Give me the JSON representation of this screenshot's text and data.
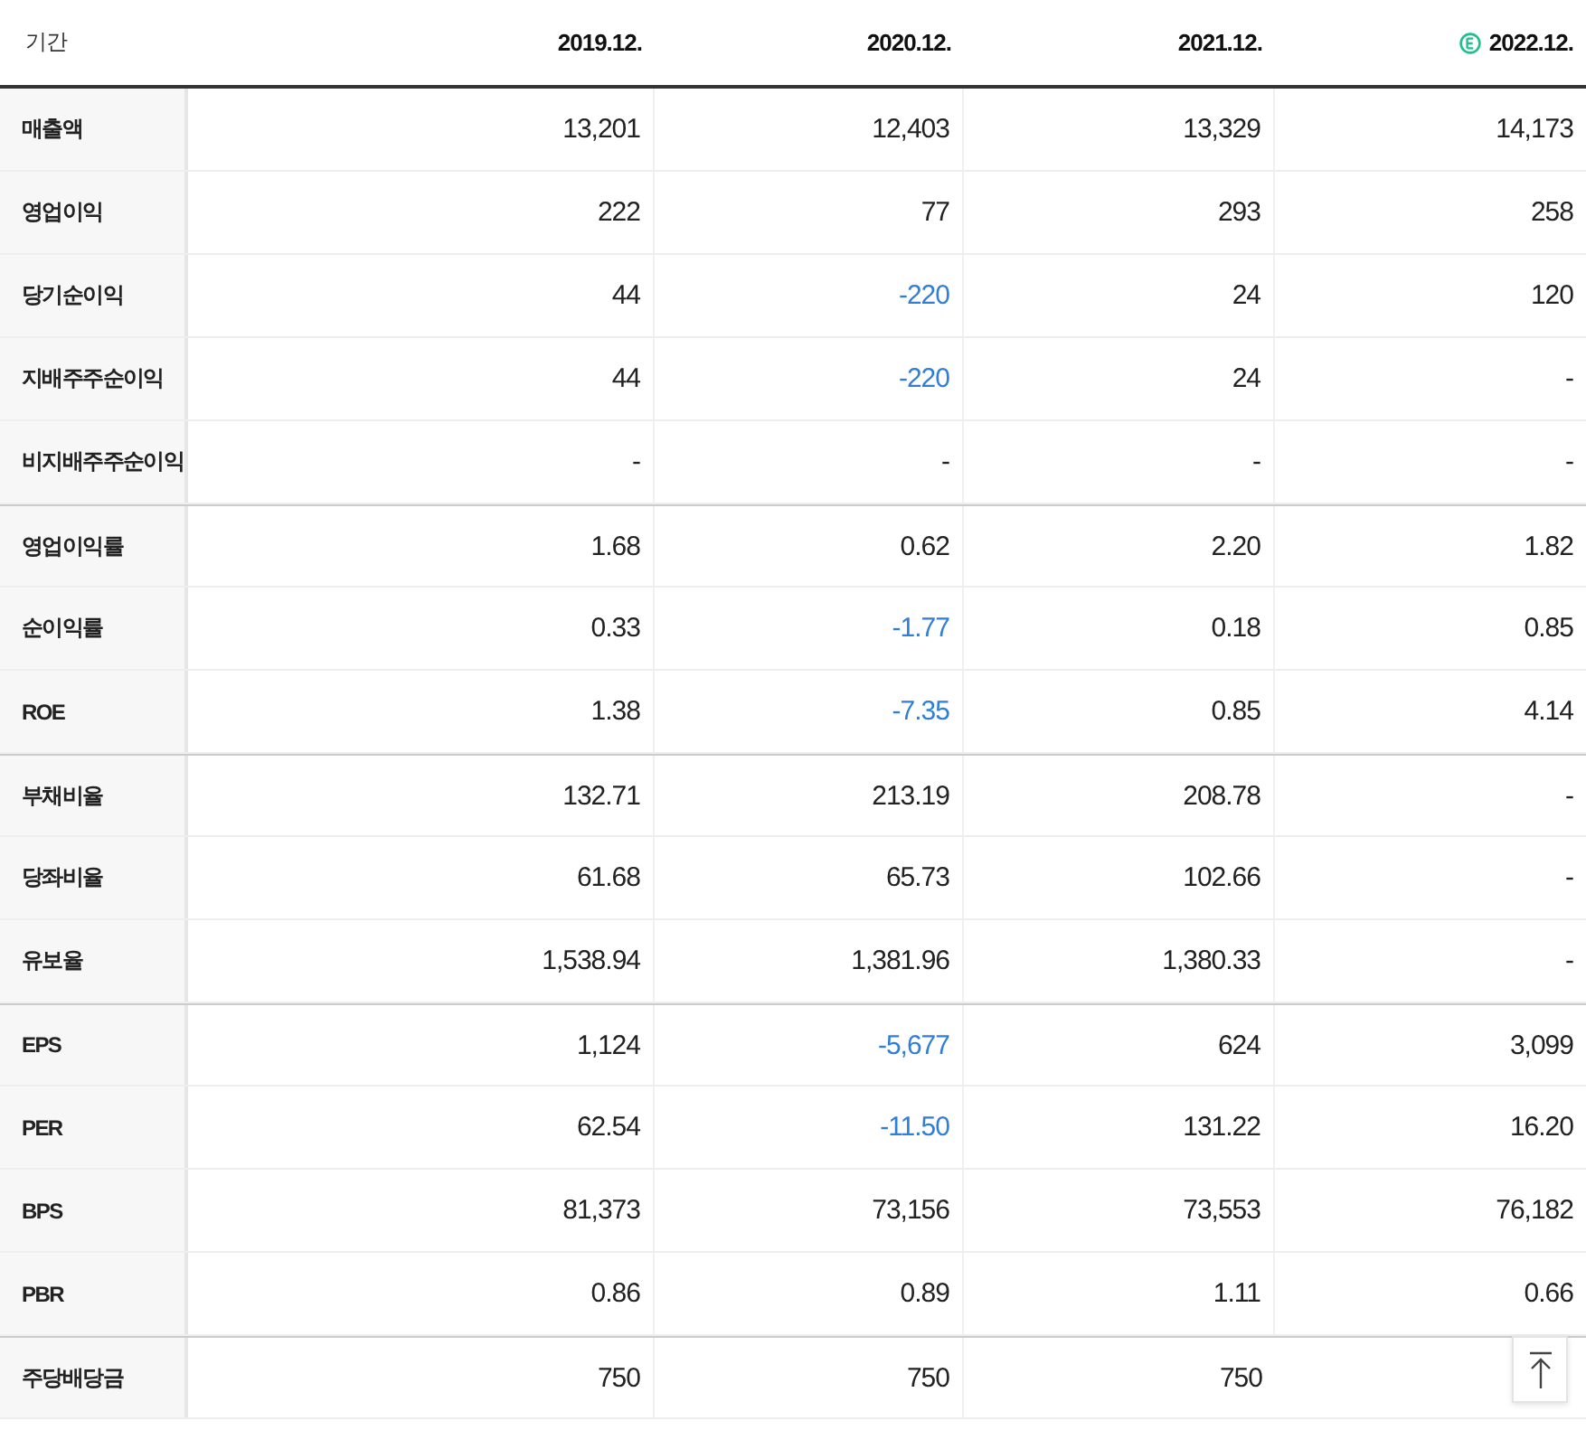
{
  "table": {
    "row_header": "기간",
    "columns": [
      {
        "label": "2019.12.",
        "estimate": false
      },
      {
        "label": "2020.12.",
        "estimate": false
      },
      {
        "label": "2021.12.",
        "estimate": false
      },
      {
        "label": "2022.12.",
        "estimate": true
      }
    ],
    "rows": [
      {
        "label": "매출액",
        "group_start": false,
        "cells": [
          {
            "text": "13,201",
            "kind": "normal"
          },
          {
            "text": "12,403",
            "kind": "normal"
          },
          {
            "text": "13,329",
            "kind": "normal"
          },
          {
            "text": "14,173",
            "kind": "normal"
          }
        ]
      },
      {
        "label": "영업이익",
        "group_start": false,
        "cells": [
          {
            "text": "222",
            "kind": "normal"
          },
          {
            "text": "77",
            "kind": "normal"
          },
          {
            "text": "293",
            "kind": "normal"
          },
          {
            "text": "258",
            "kind": "normal"
          }
        ]
      },
      {
        "label": "당기순이익",
        "group_start": false,
        "cells": [
          {
            "text": "44",
            "kind": "normal"
          },
          {
            "text": "-220",
            "kind": "negative"
          },
          {
            "text": "24",
            "kind": "normal"
          },
          {
            "text": "120",
            "kind": "normal"
          }
        ]
      },
      {
        "label": "지배주주순이익",
        "group_start": false,
        "cells": [
          {
            "text": "44",
            "kind": "normal"
          },
          {
            "text": "-220",
            "kind": "negative"
          },
          {
            "text": "24",
            "kind": "normal"
          },
          {
            "text": "-",
            "kind": "normal"
          }
        ]
      },
      {
        "label": "비지배주주순이익",
        "group_start": false,
        "cells": [
          {
            "text": "-",
            "kind": "normal"
          },
          {
            "text": "-",
            "kind": "normal"
          },
          {
            "text": "-",
            "kind": "normal"
          },
          {
            "text": "-",
            "kind": "normal"
          }
        ]
      },
      {
        "label": "영업이익률",
        "group_start": true,
        "cells": [
          {
            "text": "1.68",
            "kind": "normal"
          },
          {
            "text": "0.62",
            "kind": "normal"
          },
          {
            "text": "2.20",
            "kind": "normal"
          },
          {
            "text": "1.82",
            "kind": "normal"
          }
        ]
      },
      {
        "label": "순이익률",
        "group_start": false,
        "cells": [
          {
            "text": "0.33",
            "kind": "normal"
          },
          {
            "text": "-1.77",
            "kind": "negative"
          },
          {
            "text": "0.18",
            "kind": "normal"
          },
          {
            "text": "0.85",
            "kind": "normal"
          }
        ]
      },
      {
        "label": "ROE",
        "group_start": false,
        "cells": [
          {
            "text": "1.38",
            "kind": "normal"
          },
          {
            "text": "-7.35",
            "kind": "negative"
          },
          {
            "text": "0.85",
            "kind": "normal"
          },
          {
            "text": "4.14",
            "kind": "normal"
          }
        ]
      },
      {
        "label": "부채비율",
        "group_start": true,
        "cells": [
          {
            "text": "132.71",
            "kind": "normal"
          },
          {
            "text": "213.19",
            "kind": "normal"
          },
          {
            "text": "208.78",
            "kind": "normal"
          },
          {
            "text": "-",
            "kind": "normal"
          }
        ]
      },
      {
        "label": "당좌비율",
        "group_start": false,
        "cells": [
          {
            "text": "61.68",
            "kind": "normal"
          },
          {
            "text": "65.73",
            "kind": "normal"
          },
          {
            "text": "102.66",
            "kind": "normal"
          },
          {
            "text": "-",
            "kind": "normal"
          }
        ]
      },
      {
        "label": "유보율",
        "group_start": false,
        "cells": [
          {
            "text": "1,538.94",
            "kind": "normal"
          },
          {
            "text": "1,381.96",
            "kind": "normal"
          },
          {
            "text": "1,380.33",
            "kind": "normal"
          },
          {
            "text": "-",
            "kind": "normal"
          }
        ]
      },
      {
        "label": "EPS",
        "group_start": true,
        "cells": [
          {
            "text": "1,124",
            "kind": "normal"
          },
          {
            "text": "-5,677",
            "kind": "negative"
          },
          {
            "text": "624",
            "kind": "normal"
          },
          {
            "text": "3,099",
            "kind": "normal"
          }
        ]
      },
      {
        "label": "PER",
        "group_start": false,
        "cells": [
          {
            "text": "62.54",
            "kind": "normal"
          },
          {
            "text": "-11.50",
            "kind": "negative"
          },
          {
            "text": "131.22",
            "kind": "normal"
          },
          {
            "text": "16.20",
            "kind": "normal"
          }
        ]
      },
      {
        "label": "BPS",
        "group_start": false,
        "cells": [
          {
            "text": "81,373",
            "kind": "normal"
          },
          {
            "text": "73,156",
            "kind": "normal"
          },
          {
            "text": "73,553",
            "kind": "normal"
          },
          {
            "text": "76,182",
            "kind": "normal"
          }
        ]
      },
      {
        "label": "PBR",
        "group_start": false,
        "cells": [
          {
            "text": "0.86",
            "kind": "normal"
          },
          {
            "text": "0.89",
            "kind": "normal"
          },
          {
            "text": "1.11",
            "kind": "normal"
          },
          {
            "text": "0.66",
            "kind": "normal"
          }
        ]
      },
      {
        "label": "주당배당금",
        "group_start": true,
        "cells": [
          {
            "text": "750",
            "kind": "normal"
          },
          {
            "text": "750",
            "kind": "normal"
          },
          {
            "text": "750",
            "kind": "normal"
          }
        ]
      }
    ]
  }
}
